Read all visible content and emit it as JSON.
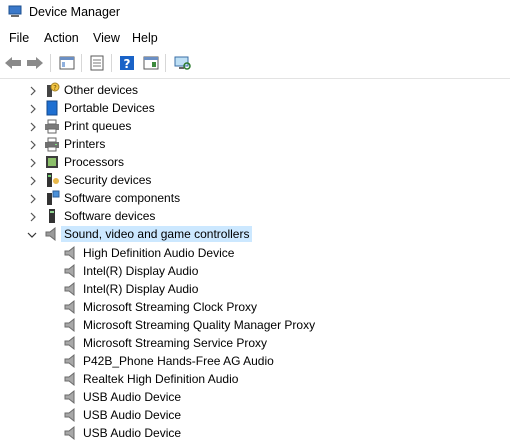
{
  "window": {
    "title": "Device Manager"
  },
  "menu": [
    "File",
    "Action",
    "View",
    "Help"
  ],
  "tree": {
    "categories": [
      {
        "label": "Other devices",
        "icon": "other-devices-icon"
      },
      {
        "label": "Portable Devices",
        "icon": "portable-devices-icon"
      },
      {
        "label": "Print queues",
        "icon": "print-queue-icon"
      },
      {
        "label": "Printers",
        "icon": "printer-icon"
      },
      {
        "label": "Processors",
        "icon": "processor-icon"
      },
      {
        "label": "Security devices",
        "icon": "security-device-icon"
      },
      {
        "label": "Software components",
        "icon": "software-component-icon"
      },
      {
        "label": "Software devices",
        "icon": "software-device-icon"
      },
      {
        "label": "Sound, video and game controllers",
        "icon": "speaker-icon",
        "expanded": true,
        "selected": true
      }
    ],
    "children": [
      "High Definition Audio Device",
      "Intel(R) Display Audio",
      "Intel(R) Display Audio",
      "Microsoft Streaming Clock Proxy",
      "Microsoft Streaming Quality Manager Proxy",
      "Microsoft Streaming Service Proxy",
      "P42B_Phone Hands-Free AG Audio",
      "Realtek High Definition Audio",
      "USB Audio Device",
      "USB Audio Device",
      "USB Audio Device"
    ]
  },
  "colors": {
    "selection": "#cce8ff",
    "accent": "#1a63c7"
  }
}
